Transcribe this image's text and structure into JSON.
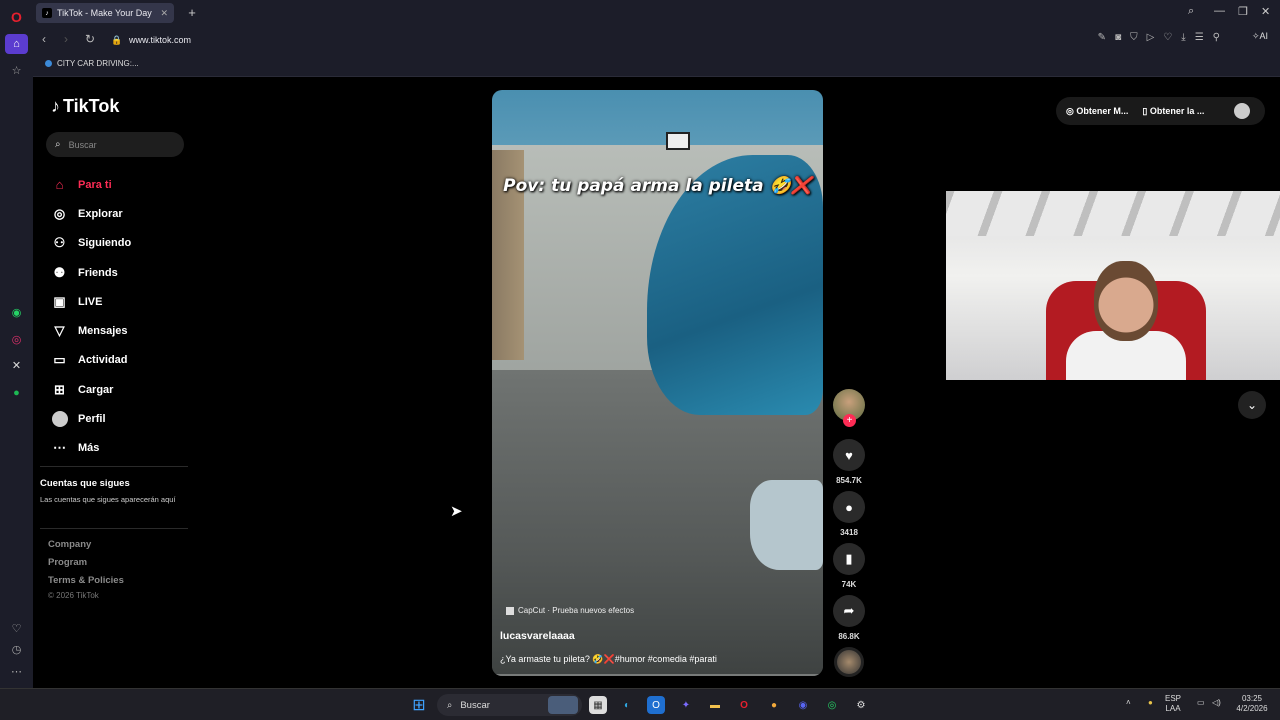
{
  "browser": {
    "tab_title": "TikTok - Make Your Day",
    "url": "www.tiktok.com",
    "bookmark": "CITY CAR DRIVING:...",
    "ai_label": "AI"
  },
  "tiktok": {
    "brand": "TikTok",
    "search_placeholder": "Buscar",
    "menu": [
      {
        "label": "Para ti"
      },
      {
        "label": "Explorar"
      },
      {
        "label": "Siguiendo"
      },
      {
        "label": "Friends"
      },
      {
        "label": "LIVE"
      },
      {
        "label": "Mensajes"
      },
      {
        "label": "Actividad"
      },
      {
        "label": "Cargar"
      },
      {
        "label": "Perfil"
      },
      {
        "label": "Más"
      }
    ],
    "following_heading": "Cuentas que sigues",
    "following_text": "Las cuentas que sigues aparecerán aquí",
    "footer": {
      "company": "Company",
      "program": "Program",
      "terms": "Terms & Policies",
      "copyright": "© 2026 TikTok"
    },
    "header_pills": {
      "get_coins": "Obtener M...",
      "get_app": "Obtener la ..."
    }
  },
  "video": {
    "caption": "Pov: tu papá arma la pileta 🤣❌",
    "effect": "CapCut · Prueba nuevos efectos",
    "author": "lucasvarelaaaa",
    "description": "¿Ya armaste tu pileta? 🤣❌#humor #comedia #parati",
    "likes": "854.7K",
    "comments": "3418",
    "saves": "74K",
    "shares": "86.8K"
  },
  "taskbar": {
    "search": "Buscar",
    "lang_top": "ESP",
    "lang_bottom": "LAA",
    "time": "03:25",
    "date": "4/2/2026"
  }
}
